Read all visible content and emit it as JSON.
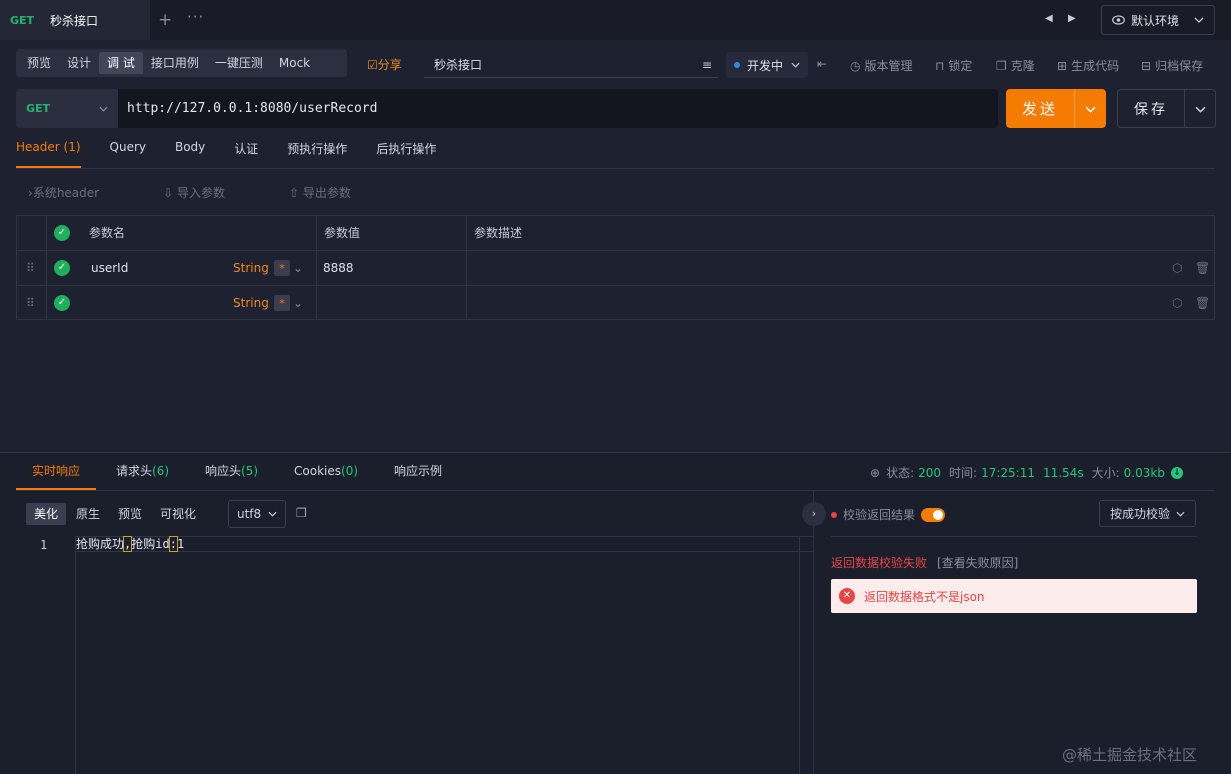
{
  "tab": {
    "method": "GET",
    "title": "秒杀接口"
  },
  "env": {
    "label": "默认环境"
  },
  "modes": [
    "预览",
    "设计",
    "调 试",
    "接口用例",
    "一键压测",
    "Mock"
  ],
  "share_label": "☑分享",
  "api_name": "秒杀接口",
  "status_label": "开发中",
  "tools": {
    "version": "版本管理",
    "lock": "锁定",
    "clone": "克隆",
    "codegen": "生成代码",
    "archive": "归档保存"
  },
  "request": {
    "method": "GET",
    "url": "http://127.0.0.1:8080/userRecord",
    "send_label": "发送",
    "save_label": "保存"
  },
  "req_tabs": [
    "Header (1)",
    "Query",
    "Body",
    "认证",
    "预执行操作",
    "后执行操作"
  ],
  "header_actions": {
    "system_header": "系统header",
    "import": "导入参数",
    "export": "导出参数"
  },
  "param_table": {
    "columns": [
      "参数名",
      "参数值",
      "参数描述"
    ],
    "rows": [
      {
        "name": "userId",
        "type": "String",
        "required": "*",
        "value": "8888",
        "desc": ""
      },
      {
        "name": "",
        "type": "String",
        "required": "*",
        "value": "",
        "desc": ""
      }
    ]
  },
  "resp_tabs": {
    "realtime": "实时响应",
    "req_headers": "请求头",
    "req_headers_count": "(6)",
    "resp_headers": "响应头",
    "resp_headers_count": "(5)",
    "cookies": "Cookies",
    "cookies_count": "(0)",
    "example": "响应示例"
  },
  "resp_meta": {
    "status_label": "状态:",
    "status": "200",
    "time_label": "时间:",
    "time": "17:25:11",
    "duration": "11.54s",
    "size_label": "大小:",
    "size": "0.03kb"
  },
  "view_modes": [
    "美化",
    "原生",
    "预览",
    "可视化"
  ],
  "encoding": "utf8",
  "code": {
    "line_no": "1",
    "part1": "抢购成功",
    "sep1": ",",
    "part2": "抢购id",
    "sep2": ":",
    "part3": "1"
  },
  "validation": {
    "label": "校验返回结果",
    "mode": "按成功校验",
    "fail_title": "返回数据校验失败",
    "fail_link": "[查看失败原因]",
    "error": "返回数据格式不是json"
  },
  "watermark": "@稀土掘金技术社区",
  "colors": {
    "accent": "#f57c00",
    "success": "#23c77a",
    "error": "#e84545",
    "get_method": "#23b36b"
  }
}
